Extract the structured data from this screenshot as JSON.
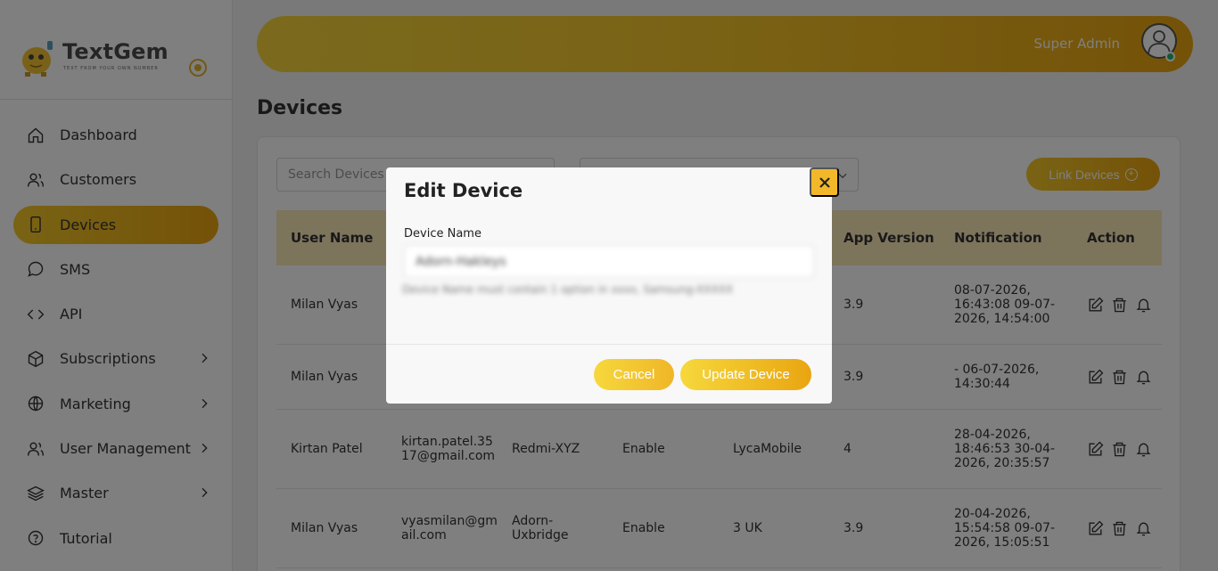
{
  "app": {
    "logo_text": "TextGem",
    "logo_tagline": "TEXT FROM YOUR OWN NUMBER",
    "accent_color": "#f3c728",
    "accent_color_dark": "#e9a511"
  },
  "sidebar": {
    "items": [
      {
        "label": "Dashboard",
        "icon": "home-icon",
        "active": false,
        "has_submenu": false
      },
      {
        "label": "Customers",
        "icon": "users-icon",
        "active": false,
        "has_submenu": false
      },
      {
        "label": "Devices",
        "icon": "phone-icon",
        "active": true,
        "has_submenu": false
      },
      {
        "label": "SMS",
        "icon": "chat-icon",
        "active": false,
        "has_submenu": false
      },
      {
        "label": "API",
        "icon": "code-icon",
        "active": false,
        "has_submenu": false
      },
      {
        "label": "Subscriptions",
        "icon": "box-icon",
        "active": false,
        "has_submenu": true
      },
      {
        "label": "Marketing",
        "icon": "globe-icon",
        "active": false,
        "has_submenu": true
      },
      {
        "label": "User Management",
        "icon": "users-icon",
        "active": false,
        "has_submenu": true
      },
      {
        "label": "Master",
        "icon": "layers-icon",
        "active": false,
        "has_submenu": true
      },
      {
        "label": "Tutorial",
        "icon": "help-icon",
        "active": false,
        "has_submenu": false
      }
    ]
  },
  "header": {
    "user_name": "Super Admin",
    "status": "online"
  },
  "page": {
    "title": "Devices",
    "search_placeholder": "Search Devices",
    "link_button_label": "Link Devices"
  },
  "table": {
    "columns": [
      "User Name",
      "",
      "",
      "",
      "",
      "App Version",
      "Notification",
      "Action"
    ],
    "rows": [
      {
        "user": "Milan Vyas",
        "email": "",
        "device": "",
        "status": "",
        "carrier": "",
        "version": "3.9",
        "notification": "08-07-2026, 16:43:08 09-07-2026, 14:54:00"
      },
      {
        "user": "Milan Vyas",
        "email": "",
        "device": "",
        "status": "",
        "carrier": "",
        "version": "3.9",
        "notification": "- 06-07-2026, 14:30:44"
      },
      {
        "user": "Kirtan Patel",
        "email": "kirtan.patel.3517@gmail.com",
        "device": "Redmi-XYZ",
        "status": "Enable",
        "carrier": "LycaMobile",
        "version": "4",
        "notification": "28-04-2026, 18:46:53 30-04-2026, 20:35:57"
      },
      {
        "user": "Milan Vyas",
        "email": "vyasmilan@gmail.com",
        "device": "Adorn-Uxbridge",
        "status": "Enable",
        "carrier": "3 UK",
        "version": "3.9",
        "notification": "20-04-2026, 15:54:58 09-07-2026, 15:05:51"
      }
    ]
  },
  "modal": {
    "title": "Edit Device",
    "field_label": "Device Name",
    "field_value": "Adorn-Hakleys",
    "field_hint": "Device Name must contain 1 option in xxxx, Samsung-XXXXX",
    "cancel_label": "Cancel",
    "update_label": "Update Device"
  }
}
